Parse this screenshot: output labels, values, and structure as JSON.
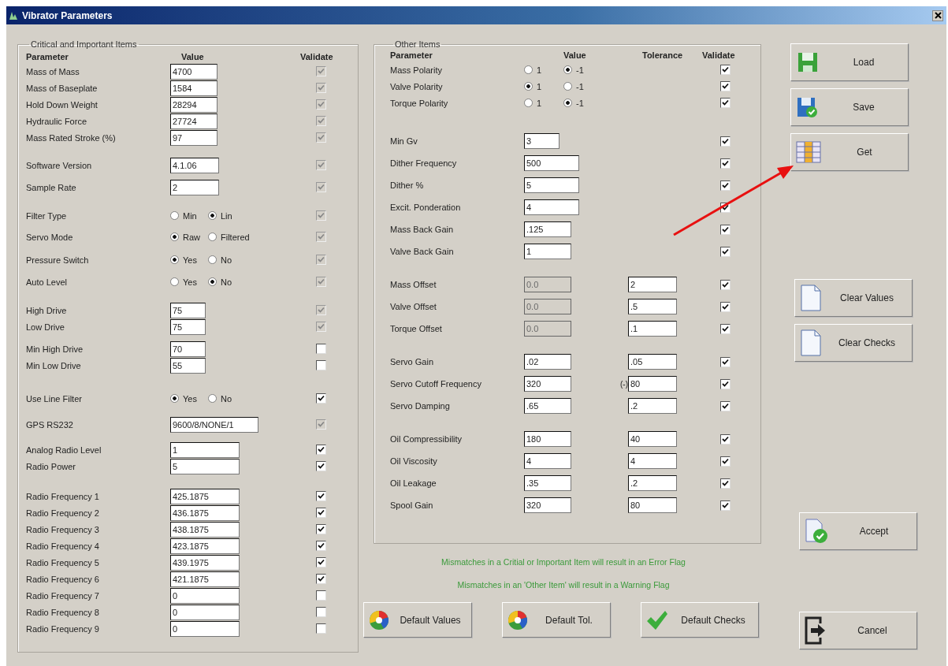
{
  "window": {
    "title": "Vibrator Parameters"
  },
  "critical": {
    "title": "Critical and Important Items",
    "headers": [
      "Parameter",
      "Value",
      "Validate"
    ],
    "groups": [
      {
        "rows": [
          {
            "label": "Mass of Mass",
            "kind": "field",
            "value": "4700",
            "validated": true,
            "validate_locked": true
          },
          {
            "label": "Mass of Baseplate",
            "kind": "field",
            "value": "1584",
            "validated": true,
            "validate_locked": true
          },
          {
            "label": "Hold Down Weight",
            "kind": "field",
            "value": "28294",
            "validated": true,
            "validate_locked": true
          },
          {
            "label": "Hydraulic Force",
            "kind": "field",
            "value": "27724",
            "validated": true,
            "validate_locked": true
          },
          {
            "label": "Mass Rated Stroke (%)",
            "kind": "field",
            "value": "97",
            "validated": true,
            "validate_locked": true
          }
        ]
      },
      {
        "rows": [
          {
            "label": "Software Version",
            "kind": "field",
            "value": "4.1.06",
            "validated": true,
            "validate_locked": true
          }
        ]
      },
      {
        "rows": [
          {
            "label": "Sample Rate",
            "kind": "field",
            "value": "2",
            "validated": true,
            "validate_locked": true
          }
        ]
      },
      {
        "rows": [
          {
            "label": "Filter Type",
            "kind": "radio",
            "options": [
              {
                "label": "Min",
                "selected": false
              },
              {
                "label": "Lin",
                "selected": true
              }
            ],
            "validated": true,
            "validate_locked": true
          }
        ]
      },
      {
        "rows": [
          {
            "label": "Servo Mode",
            "kind": "radio",
            "options": [
              {
                "label": "Raw",
                "selected": true
              },
              {
                "label": "Filtered",
                "selected": false
              }
            ],
            "validated": true,
            "validate_locked": true
          }
        ]
      },
      {
        "rows": [
          {
            "label": "Pressure Switch",
            "kind": "radio",
            "options": [
              {
                "label": "Yes",
                "selected": true
              },
              {
                "label": "No",
                "selected": false
              }
            ],
            "validated": true,
            "validate_locked": true
          }
        ]
      },
      {
        "rows": [
          {
            "label": "Auto Level",
            "kind": "radio",
            "options": [
              {
                "label": "Yes",
                "selected": false
              },
              {
                "label": "No",
                "selected": true
              }
            ],
            "validated": true,
            "validate_locked": true
          }
        ]
      },
      {
        "rows": [
          {
            "label": "High Drive",
            "kind": "field",
            "value": "75",
            "validated": true,
            "validate_locked": true
          },
          {
            "label": "Low Drive",
            "kind": "field",
            "value": "75",
            "validated": true,
            "validate_locked": true
          }
        ]
      },
      {
        "rows": [
          {
            "label": "Min High Drive",
            "kind": "field",
            "value": "70",
            "validated": false,
            "validate_locked": false
          },
          {
            "label": "Min Low Drive",
            "kind": "field",
            "value": "55",
            "validated": false,
            "validate_locked": false
          }
        ]
      },
      {
        "rows": [
          {
            "label": "Use Line Filter",
            "kind": "radio",
            "options": [
              {
                "label": "Yes",
                "selected": true
              },
              {
                "label": "No",
                "selected": false
              }
            ],
            "validated": true,
            "validate_locked": false
          }
        ]
      },
      {
        "rows": [
          {
            "label": "GPS RS232",
            "kind": "field",
            "value": "9600/8/NONE/1",
            "validated": true,
            "validate_locked": true
          }
        ]
      },
      {
        "rows": [
          {
            "label": "Analog Radio Level",
            "kind": "field",
            "value": "1",
            "validated": true,
            "validate_locked": false
          },
          {
            "label": "Radio Power",
            "kind": "field",
            "value": "5",
            "validated": true,
            "validate_locked": false
          }
        ]
      },
      {
        "rows": [
          {
            "label": "Radio Frequency 1",
            "kind": "field",
            "value": "425.1875",
            "validated": true,
            "validate_locked": false
          },
          {
            "label": "Radio Frequency 2",
            "kind": "field",
            "value": "436.1875",
            "validated": true,
            "validate_locked": false
          },
          {
            "label": "Radio Frequency 3",
            "kind": "field",
            "value": "438.1875",
            "validated": true,
            "validate_locked": false
          },
          {
            "label": "Radio Frequency 4",
            "kind": "field",
            "value": "423.1875",
            "validated": true,
            "validate_locked": false
          },
          {
            "label": "Radio Frequency 5",
            "kind": "field",
            "value": "439.1975",
            "validated": true,
            "validate_locked": false
          },
          {
            "label": "Radio Frequency 6",
            "kind": "field",
            "value": "421.1875",
            "validated": true,
            "validate_locked": false
          },
          {
            "label": "Radio Frequency 7",
            "kind": "field",
            "value": "0",
            "validated": false,
            "validate_locked": false
          },
          {
            "label": "Radio Frequency 8",
            "kind": "field",
            "value": "0",
            "validated": false,
            "validate_locked": false
          },
          {
            "label": "Radio Frequency 9",
            "kind": "field",
            "value": "0",
            "validated": false,
            "validate_locked": false
          }
        ]
      }
    ]
  },
  "other": {
    "title": "Other Items",
    "headers": [
      "Parameter",
      "Value",
      "Tolerance",
      "Validate"
    ],
    "groups": [
      {
        "rows": [
          {
            "label": "Mass Polarity",
            "kind": "radio",
            "options": [
              {
                "label": "1",
                "selected": false
              },
              {
                "label": "-1",
                "selected": true
              }
            ],
            "validated": true
          },
          {
            "label": "Valve Polarity",
            "kind": "radio",
            "options": [
              {
                "label": "1",
                "selected": true
              },
              {
                "label": "-1",
                "selected": false
              }
            ],
            "validated": true
          },
          {
            "label": "Torque Polarity",
            "kind": "radio",
            "options": [
              {
                "label": "1",
                "selected": false
              },
              {
                "label": "-1",
                "selected": true
              }
            ],
            "validated": true
          }
        ]
      },
      {
        "rows": [
          {
            "label": "Min Gv",
            "kind": "field",
            "value": "3",
            "value_disabled": false,
            "validated": true
          },
          {
            "label": "Dither Frequency",
            "kind": "field",
            "value": "500",
            "value_disabled": false,
            "validated": true
          },
          {
            "label": "Dither %",
            "kind": "field",
            "value": "5",
            "value_disabled": false,
            "validated": true
          },
          {
            "label": "Excit. Ponderation",
            "kind": "field",
            "value": "4",
            "value_disabled": false,
            "validated": true
          },
          {
            "label": "Mass Back Gain",
            "kind": "field",
            "value": ".125",
            "value_disabled": false,
            "validated": true
          },
          {
            "label": "Valve Back Gain",
            "kind": "field",
            "value": "1",
            "value_disabled": false,
            "validated": true
          }
        ]
      },
      {
        "rows": [
          {
            "label": "Mass Offset",
            "kind": "field",
            "value": "0.0",
            "value_disabled": true,
            "tolerance": "2",
            "validated": true
          },
          {
            "label": "Valve Offset",
            "kind": "field",
            "value": "0.0",
            "value_disabled": true,
            "tolerance": ".5",
            "validated": true
          },
          {
            "label": "Torque Offset",
            "kind": "field",
            "value": "0.0",
            "value_disabled": true,
            "tolerance": ".1",
            "validated": true
          }
        ]
      },
      {
        "rows": [
          {
            "label": "Servo Gain",
            "kind": "field",
            "value": ".02",
            "value_disabled": false,
            "tolerance": ".05",
            "validated": true
          },
          {
            "label": "Servo Cutoff Frequency",
            "kind": "field",
            "value": "320",
            "value_disabled": false,
            "tolerance_prefix": "(-)",
            "tolerance": "80",
            "validated": true
          },
          {
            "label": "Servo Damping",
            "kind": "field",
            "value": ".65",
            "value_disabled": false,
            "tolerance": ".2",
            "validated": true
          }
        ]
      },
      {
        "rows": [
          {
            "label": "Oil Compressibility",
            "kind": "field",
            "value": "180",
            "value_disabled": false,
            "tolerance": "40",
            "validated": true
          },
          {
            "label": "Oil Viscosity",
            "kind": "field",
            "value": "4",
            "value_disabled": false,
            "tolerance": "4",
            "validated": true
          },
          {
            "label": "Oil Leakage",
            "kind": "field",
            "value": ".35",
            "value_disabled": false,
            "tolerance": ".2",
            "validated": true
          },
          {
            "label": "Spool Gain",
            "kind": "field",
            "value": "320",
            "value_disabled": false,
            "tolerance": "80",
            "validated": true
          }
        ]
      }
    ]
  },
  "notes": [
    "Mismatches in a Critial or Important Item will result in an Error Flag",
    "Mismatches in an 'Other Item' will result in a Warning Flag"
  ],
  "default_buttons": [
    {
      "label": "Default Values",
      "kind": "wheel"
    },
    {
      "label": "Default Tol.",
      "kind": "wheel"
    },
    {
      "label": "Default Checks",
      "kind": "check"
    }
  ],
  "side_groups": [
    {
      "buttons": [
        {
          "label": "Load",
          "kind": "load"
        },
        {
          "label": "Save",
          "kind": "save"
        },
        {
          "label": "Get",
          "kind": "get"
        }
      ]
    },
    {
      "buttons": [
        {
          "label": "Clear Values",
          "kind": "clear"
        },
        {
          "label": "Clear Checks",
          "kind": "clear"
        }
      ]
    },
    {
      "buttons": [
        {
          "label": "Accept",
          "kind": "accept"
        }
      ]
    },
    {
      "buttons": [
        {
          "label": "Cancel",
          "kind": "cancel"
        }
      ]
    }
  ]
}
